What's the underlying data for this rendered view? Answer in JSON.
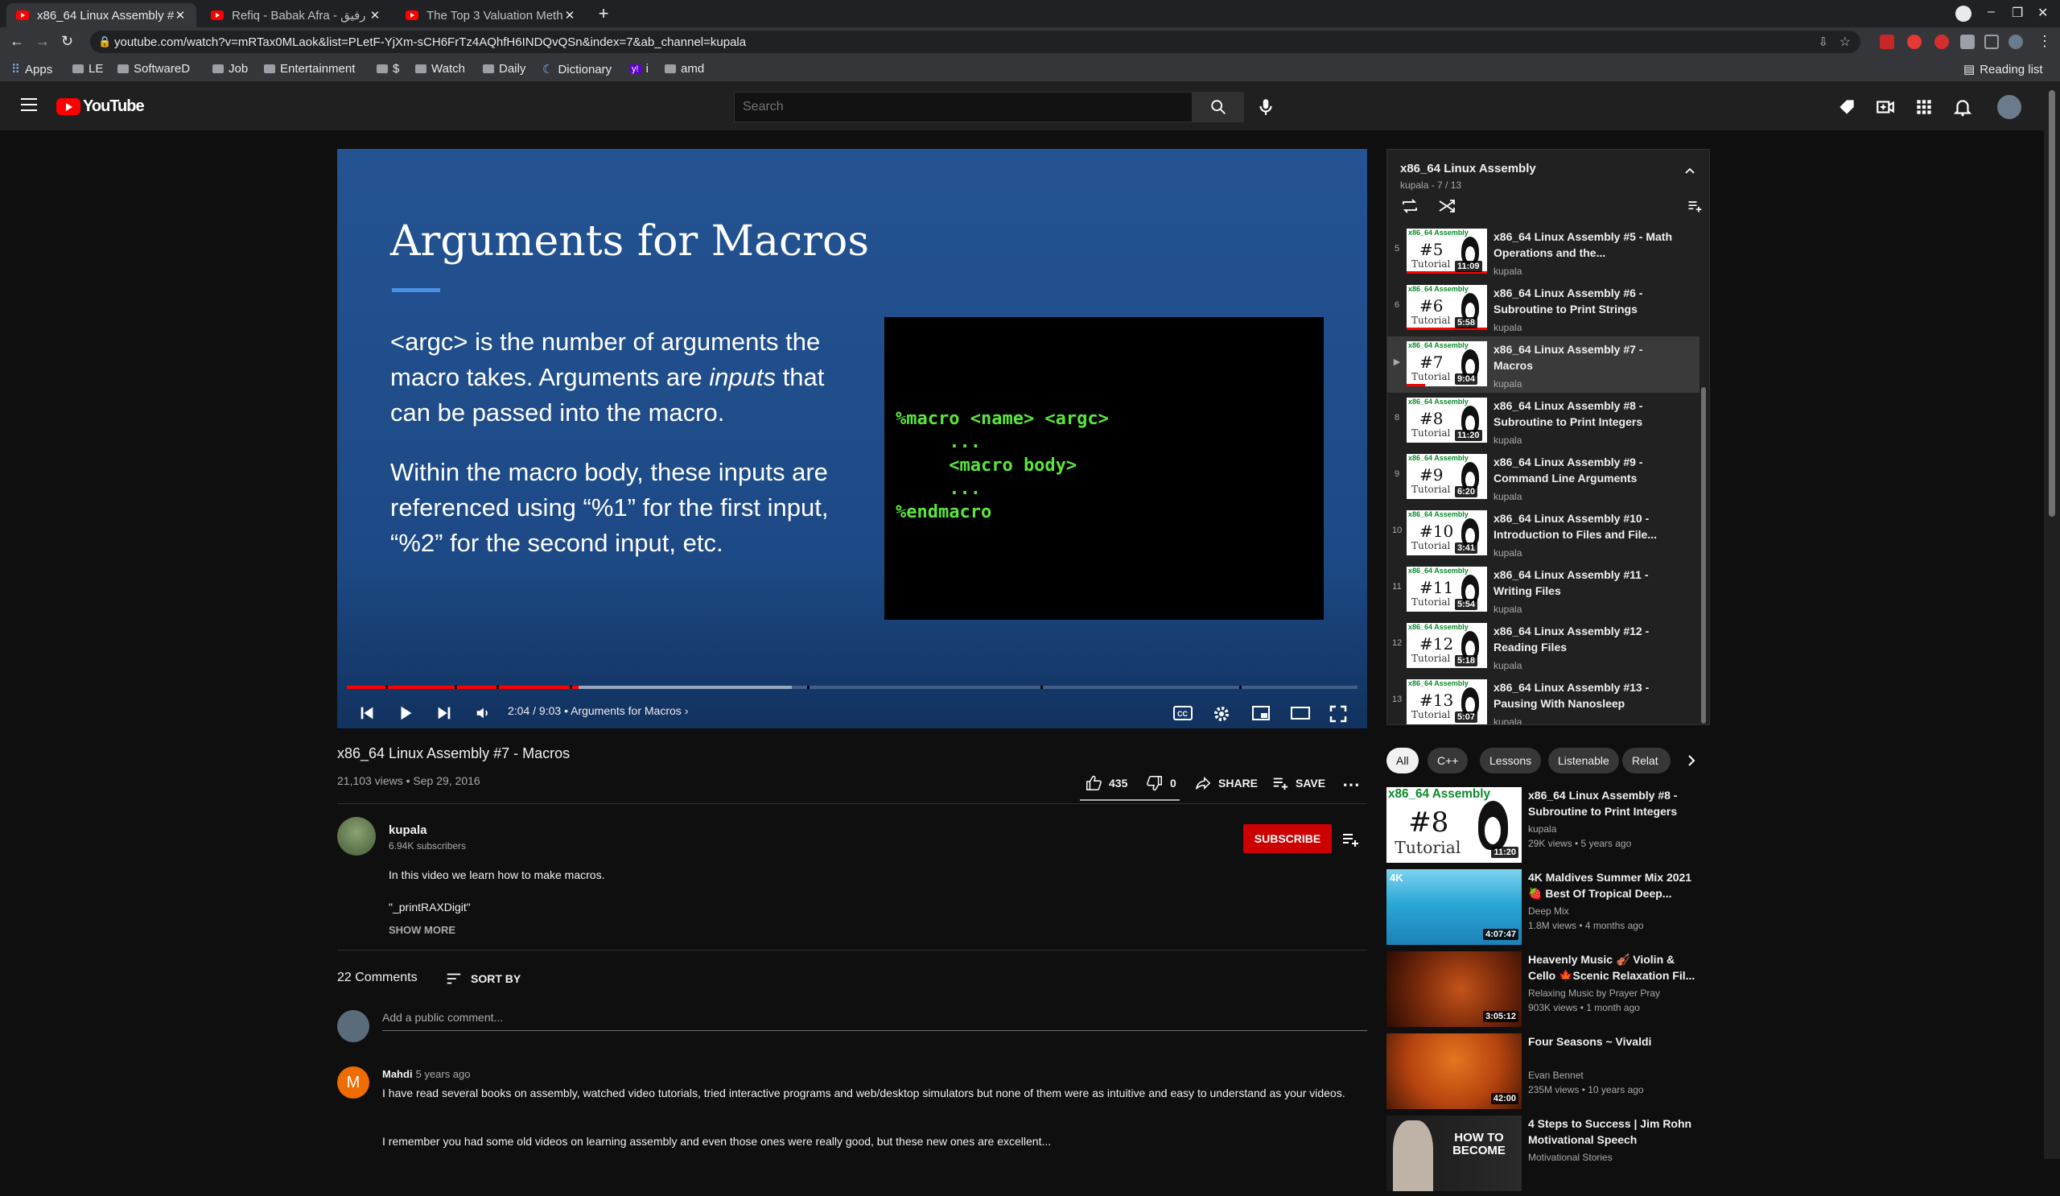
{
  "browser": {
    "tabs": [
      {
        "title": "x86_64 Linux Assembly #7 - Macros"
      },
      {
        "title": "Refiq - Babak Afra - رفیق"
      },
      {
        "title": "The Top 3 Valuation Methods"
      }
    ],
    "url": "youtube.com/watch?v=mRTax0MLaok&list=PLetF-YjXm-sCH6FrTz4AQhfH6INDQvQSn&index=7&ab_channel=kupala",
    "bookmarks": [
      "Apps",
      "LE",
      "SoftwareD",
      "Job",
      "Entertainment",
      "$",
      "Watch",
      "Daily",
      "Dictionary",
      "i",
      "amd"
    ],
    "reading_list": "Reading list"
  },
  "header": {
    "logo_text": "YouTube",
    "search_placeholder": "Search"
  },
  "player": {
    "slide_title": "Arguments for Macros",
    "slide_p1_a": "<argc> is the number of arguments the macro takes. Arguments are ",
    "slide_p1_em": "inputs",
    "slide_p1_b": " that can be passed into the macro.",
    "slide_p2": "Within the macro body, these inputs are referenced using “%1” for the first input, “%2” for the second input, etc.",
    "code": "%macro <name> <argc>\n     ...\n     <macro body>\n     ...\n%endmacro",
    "time": "2:04 / 9:03",
    "chapter": "• Arguments for Macros",
    "progress": 0.229,
    "buffered": 0.44
  },
  "video": {
    "title": "x86_64 Linux Assembly #7 - Macros",
    "meta": "21,103 views • Sep 29, 2016",
    "likes": "435",
    "dislikes": "0",
    "share": "SHARE",
    "save": "SAVE",
    "channel": "kupala",
    "subscribers": "6.94K subscribers",
    "subscribe": "SUBSCRIBE",
    "description_1": "In this video we learn how to make macros.",
    "description_2": "\"_printRAXDigit\"",
    "show_more": "SHOW MORE"
  },
  "comments": {
    "count": "22 Comments",
    "sort": "SORT BY",
    "placeholder": "Add a public comment...",
    "items": [
      {
        "avatar": "M",
        "author": "Mahdi",
        "time": "5 years ago",
        "text1": "I have read several books on assembly, watched video tutorials, tried interactive programs and web/desktop simulators but none of them were as intuitive and easy to understand as your videos.",
        "text2": "I remember you had some old videos on learning assembly and even those ones were really good, but these new ones are excellent..."
      }
    ]
  },
  "playlist": {
    "title": "x86_64 Linux Assembly",
    "sub": "kupala - 7 / 13",
    "items": [
      {
        "idx": "5",
        "num": "#5",
        "title": "x86_64 Linux Assembly #5 - Math Operations and the...",
        "channel": "kupala",
        "duration": "11:09"
      },
      {
        "idx": "6",
        "num": "#6",
        "title": "x86_64 Linux Assembly #6 - Subroutine to Print Strings",
        "channel": "kupala",
        "duration": "5:58"
      },
      {
        "idx": "▶",
        "num": "#7",
        "title": "x86_64 Linux Assembly #7 - Macros",
        "channel": "kupala",
        "duration": "9:04"
      },
      {
        "idx": "8",
        "num": "#8",
        "title": "x86_64 Linux Assembly #8 - Subroutine to Print Integers",
        "channel": "kupala",
        "duration": "11:20"
      },
      {
        "idx": "9",
        "num": "#9",
        "title": "x86_64 Linux Assembly #9 - Command Line Arguments",
        "channel": "kupala",
        "duration": "6:20"
      },
      {
        "idx": "10",
        "num": "#10",
        "title": "x86_64 Linux Assembly #10 - Introduction to Files and File...",
        "channel": "kupala",
        "duration": "3:41"
      },
      {
        "idx": "11",
        "num": "#11",
        "title": "x86_64 Linux Assembly #11 - Writing Files",
        "channel": "kupala",
        "duration": "5:54"
      },
      {
        "idx": "12",
        "num": "#12",
        "title": "x86_64 Linux Assembly #12 - Reading Files",
        "channel": "kupala",
        "duration": "5:18"
      },
      {
        "idx": "13",
        "num": "#13",
        "title": "x86_64 Linux Assembly #13 - Pausing With Nanosleep",
        "channel": "kupala",
        "duration": "5:07"
      }
    ],
    "thumb_tag": "x86_64 Assembly",
    "thumb_tut": "Tutorial"
  },
  "chips": [
    "All",
    "C++",
    "Lessons",
    "Listenable",
    "Relat"
  ],
  "recommendations": [
    {
      "title": "x86_64 Linux Assembly #8 - Subroutine to Print Integers",
      "channel": "kupala",
      "meta": "29K views • 5 years ago",
      "duration": "11:20",
      "num": "#8"
    },
    {
      "title": "4K Maldives Summer Mix 2021 🍓 Best Of Tropical Deep...",
      "channel": "Deep Mix",
      "meta": "1.8M views • 4 months ago",
      "duration": "4:07:47",
      "badge": "4K"
    },
    {
      "title": "Heavenly Music 🎻 Violin & Cello 🍁Scenic Relaxation Fil...",
      "channel": "Relaxing Music by Prayer Pray",
      "meta": "903K views • 1 month ago",
      "duration": "3:05:12"
    },
    {
      "title": "Four Seasons ~ Vivaldi",
      "channel": "Evan Bennet",
      "meta": "235M views • 10 years ago",
      "duration": "42:00"
    },
    {
      "title": "4 Steps to Success | Jim Rohn Motivational Speech",
      "channel": "Motivational Stories",
      "meta": "",
      "duration": "",
      "thumb_text": "HOW TO BECOME"
    }
  ]
}
